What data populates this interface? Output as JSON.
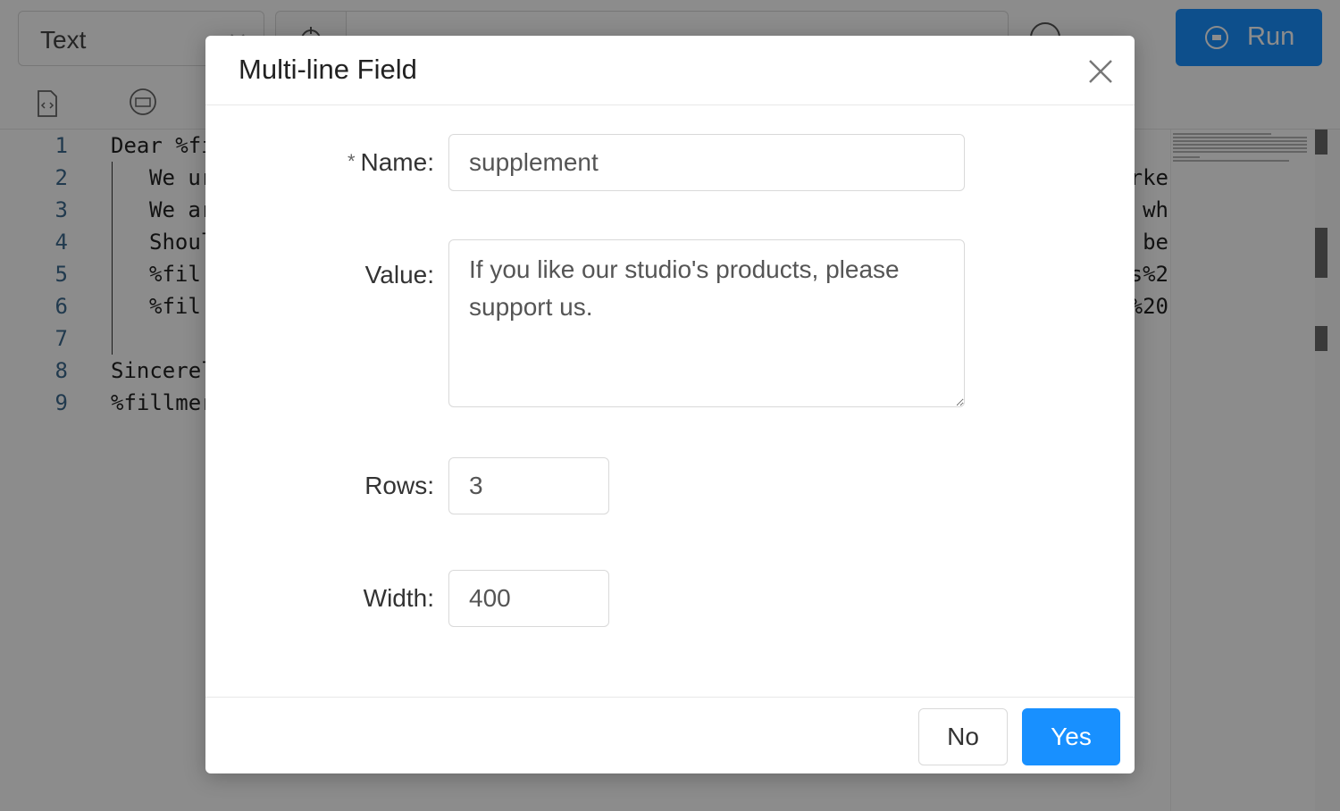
{
  "toolbar": {
    "mode_select": "Text",
    "run_label": "Run"
  },
  "editor": {
    "lines": [
      {
        "n": "1",
        "left": "Dear %fi",
        "right": ""
      },
      {
        "n": "2",
        "left": "We ur",
        "right": "rke"
      },
      {
        "n": "3",
        "left": "We ar",
        "right": "wh"
      },
      {
        "n": "4",
        "left": "Shoul",
        "right": "be"
      },
      {
        "n": "5",
        "left": "%fil",
        "right": "s%2"
      },
      {
        "n": "6",
        "left": "%fil",
        "right": "%20"
      },
      {
        "n": "7",
        "left": "",
        "right": ""
      },
      {
        "n": "8",
        "left": "Sincerel",
        "right": ""
      },
      {
        "n": "9",
        "left": "%fillmer",
        "right": ""
      }
    ]
  },
  "modal": {
    "title": "Multi-line Field",
    "name_label": "Name",
    "required_mark": "*",
    "name_value": "supplement",
    "value_label": "Value",
    "value_text": "If you like our studio's products, please support us.",
    "rows_label": "Rows",
    "rows_value": "3",
    "width_label": "Width",
    "width_value": "400",
    "colon": ":",
    "no_label": "No",
    "yes_label": "Yes"
  },
  "colors": {
    "primary": "#1890ff",
    "overlay": "rgba(0,0,0,0.45)"
  }
}
